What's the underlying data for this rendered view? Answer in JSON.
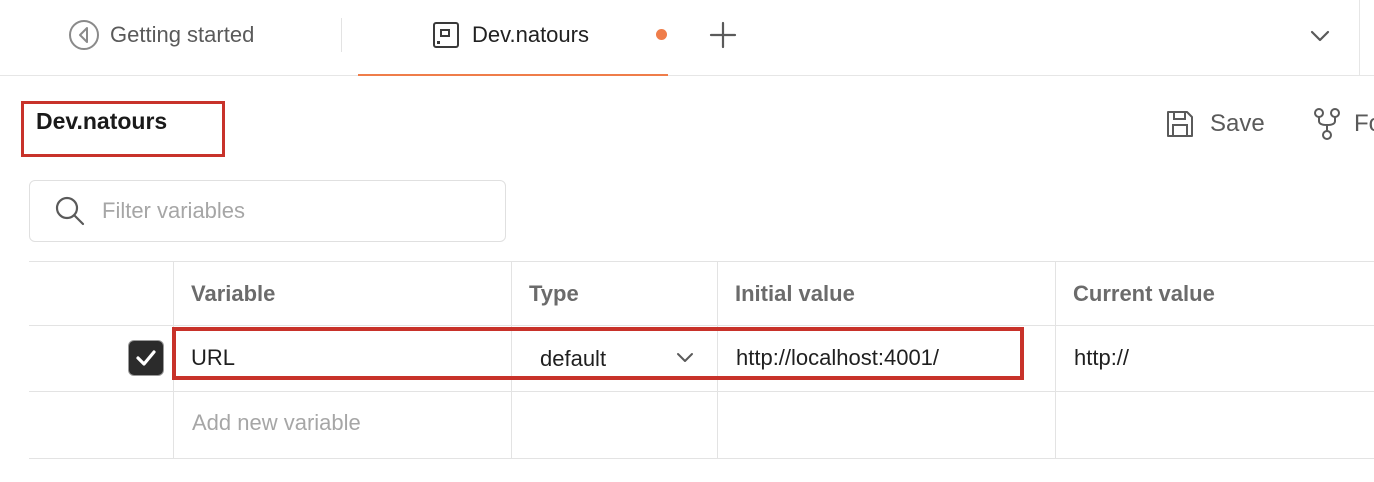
{
  "tabs": [
    {
      "label": "Getting started",
      "icon": "getting-started-icon",
      "active": false
    },
    {
      "label": "Dev.natours",
      "icon": "environment-icon",
      "active": true,
      "unsaved": true
    }
  ],
  "header": {
    "title": "Dev.natours",
    "save_label": "Save",
    "fork_label": "Fo"
  },
  "search": {
    "placeholder": "Filter variables",
    "value": ""
  },
  "table": {
    "columns": [
      "Variable",
      "Type",
      "Initial value",
      "Current value"
    ],
    "rows": [
      {
        "checked": true,
        "variable": "URL",
        "type": "default",
        "initial_value": "http://localhost:4001/",
        "current_value": "http://"
      }
    ],
    "add_placeholder": "Add new variable"
  },
  "colors": {
    "accent": "#ef7d4a",
    "highlight": "#c8322a"
  }
}
